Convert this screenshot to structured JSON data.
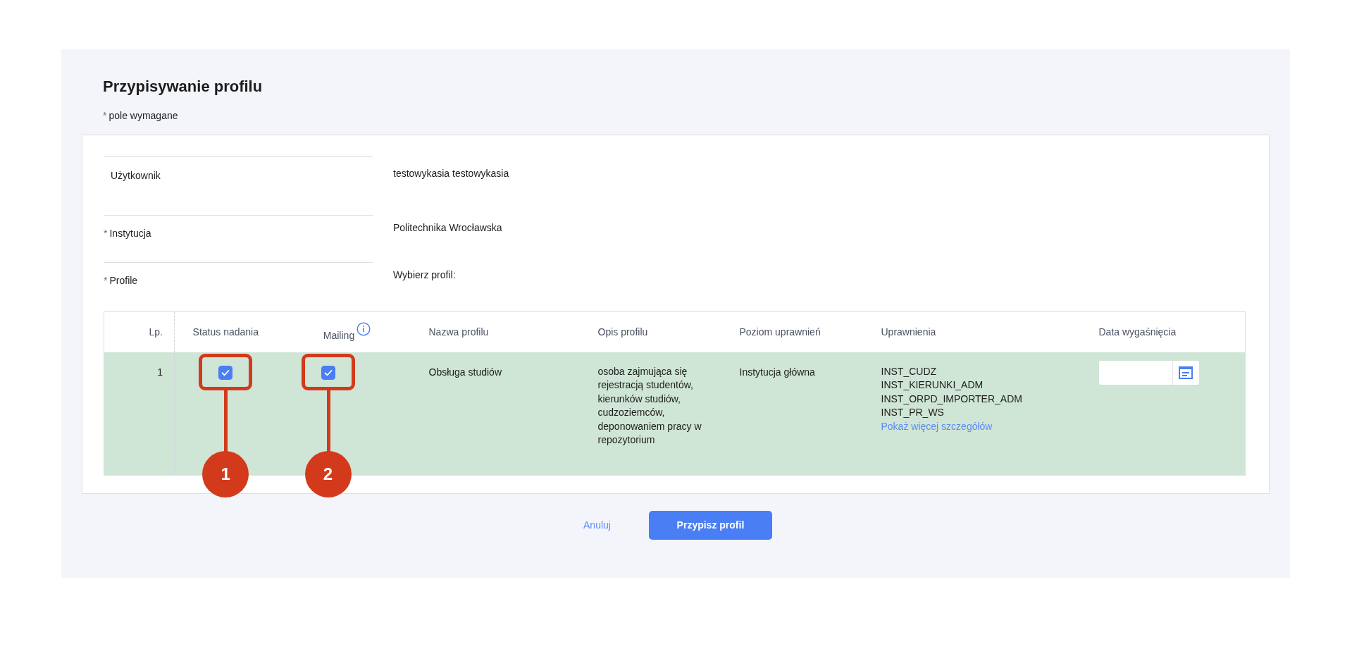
{
  "page": {
    "title": "Przypisywanie profilu",
    "required_note": {
      "mark": "*",
      "text": "pole wymagane"
    }
  },
  "fields": [
    {
      "label": "Użytkownik",
      "required": false,
      "value": "testowykasia testowykasia"
    },
    {
      "label": "Instytucja",
      "required": true,
      "value": "Politechnika Wrocławska"
    },
    {
      "label": "Profile",
      "required": true,
      "value": "Wybierz profil:"
    }
  ],
  "required_mark": "*",
  "table": {
    "columns": [
      {
        "label": "Lp.",
        "kind": "plain"
      },
      {
        "label": "Status nadania",
        "kind": "plain"
      },
      {
        "label": "Mailing",
        "kind": "info"
      },
      {
        "label": "Nazwa profilu",
        "kind": "plain"
      },
      {
        "label": "Opis profilu",
        "kind": "plain"
      },
      {
        "label": "Poziom uprawnień",
        "kind": "plain"
      },
      {
        "label": "Uprawnienia",
        "kind": "plain"
      },
      {
        "label": "Data wygaśnięcia",
        "kind": "plain"
      }
    ],
    "rows": [
      {
        "lp": "1",
        "selected": true,
        "status": {
          "checked": true,
          "callout": "1"
        },
        "mailing": {
          "checked": true,
          "callout": "2"
        },
        "name": "Obsługa studiów",
        "description": "osoba zajmująca się rejestracją studentów, kierunków studiów, cudzoziemców, deponowaniem pracy w repozytorium",
        "access_level": "Instytucja główna",
        "permissions": [
          "INST_CUDZ",
          "INST_KIERUNKI_ADM",
          "INST_ORPD_IMPORTER_ADM",
          "INST_PR_WS"
        ],
        "details_link": "Pokaż więcej szczegółów"
      }
    ]
  },
  "buttons": {
    "cancel": "Anuluj",
    "submit": "Przypisz profil"
  }
}
